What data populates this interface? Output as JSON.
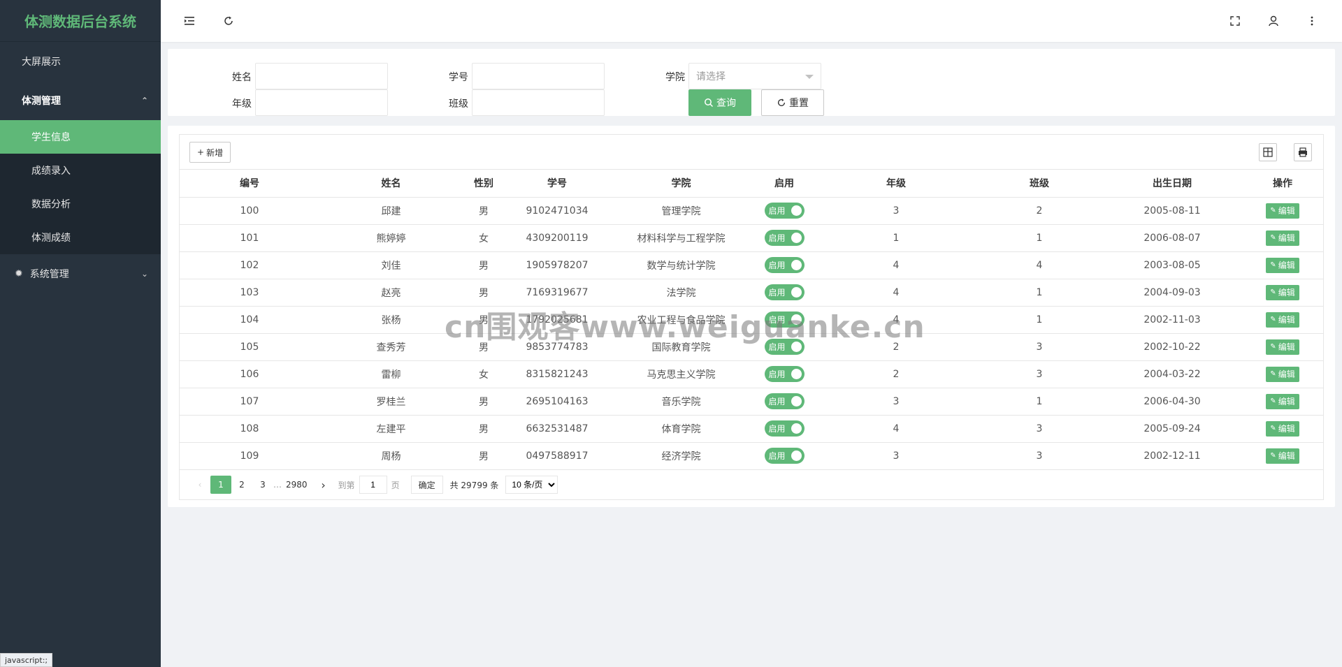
{
  "app": {
    "title": "体测数据后台系统"
  },
  "sidebar": {
    "items": [
      {
        "label": "大屏展示"
      },
      {
        "label": "体测管理",
        "caret": "^"
      }
    ],
    "sub": [
      {
        "label": "学生信息"
      },
      {
        "label": "成绩录入"
      },
      {
        "label": "数据分析"
      },
      {
        "label": "体测成绩"
      }
    ],
    "system": {
      "label": "系统管理",
      "caret": "v"
    }
  },
  "topbar": {
    "icons": [
      "menu-fold-icon",
      "refresh-icon",
      "fullscreen-icon",
      "user-icon",
      "more-icon"
    ]
  },
  "search": {
    "name_label": "姓名",
    "id_label": "学号",
    "college_label": "学院",
    "grade_label": "年级",
    "class_label": "班级",
    "college_placeholder": "请选择",
    "query_label": "查询",
    "reset_label": "重置"
  },
  "toolbar": {
    "add_label": "新增"
  },
  "table": {
    "headers": [
      "编号",
      "姓名",
      "性别",
      "学号",
      "学院",
      "启用",
      "年级",
      "班级",
      "出生日期",
      "操作"
    ],
    "switch_label": "启用",
    "edit_label": "编辑",
    "rows": [
      [
        "100",
        "邱建",
        "男",
        "9102471034",
        "管理学院",
        "3",
        "2",
        "2005-08-11"
      ],
      [
        "101",
        "熊婷婷",
        "女",
        "4309200119",
        "材料科学与工程学院",
        "1",
        "1",
        "2006-08-07"
      ],
      [
        "102",
        "刘佳",
        "男",
        "1905978207",
        "数学与统计学院",
        "4",
        "4",
        "2003-08-05"
      ],
      [
        "103",
        "赵亮",
        "男",
        "7169319677",
        "法学院",
        "4",
        "1",
        "2004-09-03"
      ],
      [
        "104",
        "张杨",
        "男",
        "1792025681",
        "农业工程与食品学院",
        "4",
        "1",
        "2002-11-03"
      ],
      [
        "105",
        "查秀芳",
        "男",
        "9853774783",
        "国际教育学院",
        "2",
        "3",
        "2002-10-22"
      ],
      [
        "106",
        "雷柳",
        "女",
        "8315821243",
        "马克思主义学院",
        "2",
        "3",
        "2004-03-22"
      ],
      [
        "107",
        "罗桂兰",
        "男",
        "2695104163",
        "音乐学院",
        "3",
        "1",
        "2006-04-30"
      ],
      [
        "108",
        "左建平",
        "男",
        "6632531487",
        "体育学院",
        "4",
        "3",
        "2005-09-24"
      ],
      [
        "109",
        "周杨",
        "男",
        "0497588917",
        "经济学院",
        "3",
        "3",
        "2002-12-11"
      ]
    ]
  },
  "pager": {
    "pages": [
      "1",
      "2",
      "3"
    ],
    "ellipsis": "…",
    "last": "2980",
    "goto_label": "到第",
    "goto_value": "1",
    "page_unit": "页",
    "confirm_label": "确定",
    "total_label": "共 29799 条",
    "per_page": "10 条/页"
  },
  "watermark": "cn围观客www.weiguanke.cn",
  "status_tip": "javascript:;"
}
